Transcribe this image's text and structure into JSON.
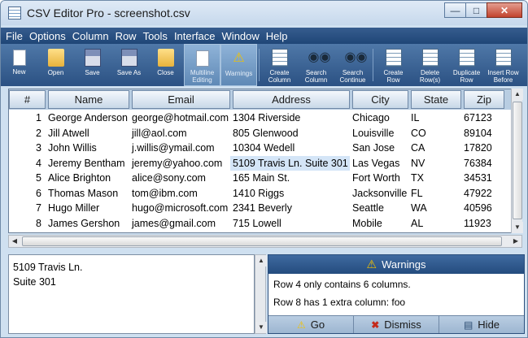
{
  "window": {
    "title": "CSV Editor Pro - screenshot.csv"
  },
  "menu": [
    "File",
    "Options",
    "Column",
    "Row",
    "Tools",
    "Interface",
    "Window",
    "Help"
  ],
  "toolbar": [
    {
      "label": "New",
      "icon": "new-file-icon"
    },
    {
      "label": "Open",
      "icon": "open-folder-icon"
    },
    {
      "label": "Save",
      "icon": "save-disk-icon"
    },
    {
      "label": "Save As",
      "icon": "save-as-icon"
    },
    {
      "label": "Close",
      "icon": "close-folder-icon"
    },
    {
      "label": "Multiline\nEditing",
      "icon": "multiline-edit-icon",
      "active": true
    },
    {
      "label": "Warnings",
      "icon": "warning-icon",
      "active": true
    },
    {
      "label": "Create\nColumn",
      "icon": "create-column-icon"
    },
    {
      "label": "Search\nColumn",
      "icon": "binoculars-icon"
    },
    {
      "label": "Search\nContinue",
      "icon": "binoculars-continue-icon"
    },
    {
      "label": "Create\nRow",
      "icon": "create-row-icon"
    },
    {
      "label": "Delete\nRow(s)",
      "icon": "delete-row-icon"
    },
    {
      "label": "Duplicate\nRow",
      "icon": "duplicate-row-icon"
    },
    {
      "label": "Insert Row\nBefore",
      "icon": "insert-row-icon"
    }
  ],
  "grid": {
    "columns": [
      "#",
      "Name",
      "Email",
      "Address",
      "City",
      "State",
      "Zip"
    ],
    "rows": [
      [
        "1",
        "George Anderson",
        "george@hotmail.com",
        "1304 Riverside",
        "Chicago",
        "IL",
        "67123"
      ],
      [
        "2",
        "Jill Atwell",
        "jill@aol.com",
        "805 Glenwood",
        "Louisville",
        "CO",
        "89104"
      ],
      [
        "3",
        "John Willis",
        "j.willis@ymail.com",
        "10304 Wedell",
        "San Jose",
        "CA",
        "17820"
      ],
      [
        "4",
        "Jeremy Bentham",
        "jeremy@yahoo.com",
        "5109 Travis Ln. Suite 301",
        "Las Vegas",
        "NV",
        "76384"
      ],
      [
        "5",
        "Alice Brighton",
        "alice@sony.com",
        "165 Main St.",
        "Fort Worth",
        "TX",
        "34531"
      ],
      [
        "6",
        "Thomas Mason",
        "tom@ibm.com",
        "1410 Riggs",
        "Jacksonville",
        "FL",
        "47922"
      ],
      [
        "7",
        "Hugo Miller",
        "hugo@microsoft.com",
        "2341 Beverly",
        "Seattle",
        "WA",
        "40596"
      ],
      [
        "8",
        "James Gershon",
        "james@gmail.com",
        "715 Lowell",
        "Mobile",
        "AL",
        "11923"
      ]
    ],
    "selected_cell": {
      "row": 4,
      "column": "Address"
    }
  },
  "detail": {
    "text": "5109 Travis Ln.\nSuite 301"
  },
  "warnings": {
    "title": "Warnings",
    "messages": [
      "Row 4 only contains 6 columns.",
      "Row 8 has 1 extra column: foo"
    ],
    "buttons": [
      {
        "label": "Go",
        "icon": "warning-icon"
      },
      {
        "label": "Dismiss",
        "icon": "close-x-icon"
      },
      {
        "label": "Hide",
        "icon": "hide-icon"
      }
    ]
  }
}
